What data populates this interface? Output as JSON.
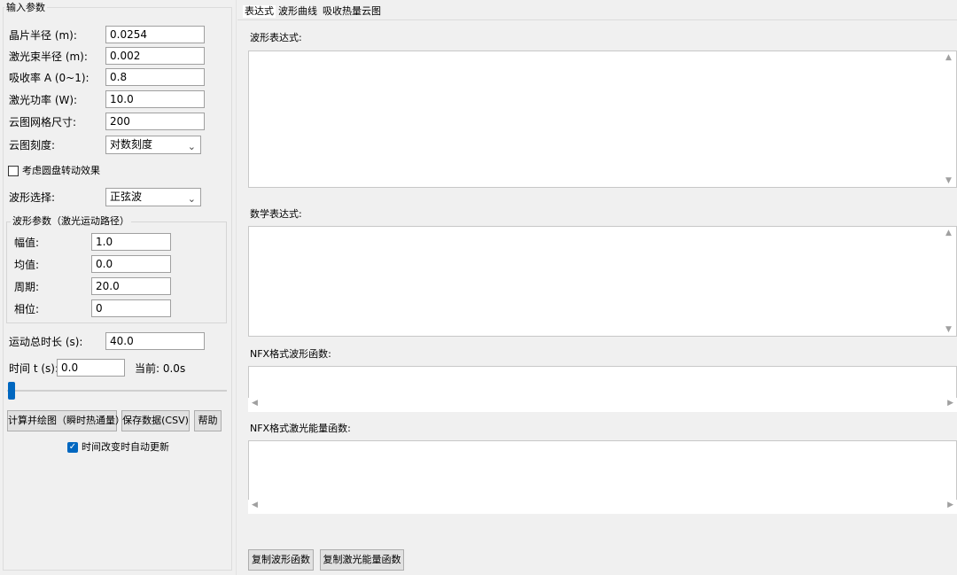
{
  "left_panel": {
    "group_title": "输入参数",
    "fields": [
      {
        "label": "晶片半径 (m):",
        "value": "0.0254"
      },
      {
        "label": "激光束半径 (m):",
        "value": "0.002"
      },
      {
        "label": "吸收率 A (0~1):",
        "value": "0.8"
      },
      {
        "label": "激光功率 (W):",
        "value": "10.0"
      },
      {
        "label": "云图网格尺寸:",
        "value": "200"
      }
    ],
    "scale_label": "云图刻度:",
    "scale_value": "对数刻度",
    "rotation_checkbox_label": "考虑圆盘转动效果",
    "rotation_checked": false,
    "wave_select_label": "波形选择:",
    "wave_select_value": "正弦波",
    "wave_params": {
      "title": "波形参数（激光运动路径）",
      "fields": [
        {
          "label": "幅值:",
          "value": "1.0"
        },
        {
          "label": "均值:",
          "value": "0.0"
        },
        {
          "label": "周期:",
          "value": "20.0"
        },
        {
          "label": "相位:",
          "value": "0"
        }
      ]
    },
    "duration_label": "运动总时长 (s):",
    "duration_value": "40.0",
    "time_label": "时间 t (s):",
    "time_value": "0.0",
    "current_label": "当前: 0.0s",
    "slider_value": 0,
    "buttons": {
      "compute": "计算并绘图（瞬时热通量）",
      "save": "保存数据(CSV)",
      "help": "帮助"
    },
    "auto_update_label": "时间改变时自动更新",
    "auto_update_checked": true
  },
  "right_panel": {
    "tabs": [
      "表达式",
      "波形曲线",
      "吸收热量云图"
    ],
    "active_tab": 0,
    "wave_expr_label": "波形表达式:",
    "math_expr_label": "数学表达式:",
    "nfx_wave_label": "NFX格式波形函数:",
    "nfx_energy_label": "NFX格式激光能量函数:",
    "copy_wave_button": "复制波形函数",
    "copy_energy_button": "复制激光能量函数"
  },
  "colors": {
    "accent": "#0067c0",
    "window_bg": "#f0f0f0"
  },
  "icons": {
    "checkbox_checked": "✓",
    "dropdown": "chevron-down",
    "scroll_up": "▲",
    "scroll_down": "▼",
    "scroll_left": "◀",
    "scroll_right": "▶"
  }
}
